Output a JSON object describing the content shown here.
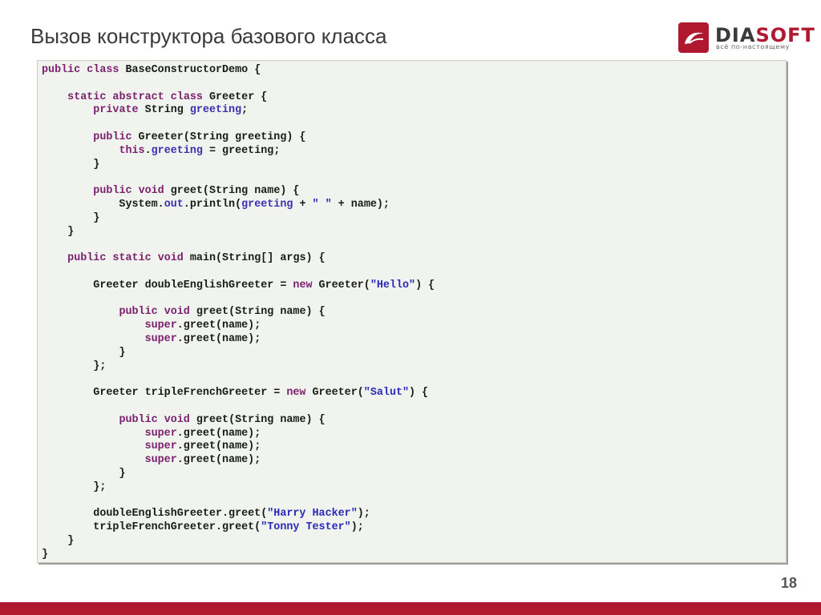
{
  "slide": {
    "title": "Вызов конструктора базового класса",
    "page_number": "18"
  },
  "logo": {
    "brand_dia": "DIA",
    "brand_soft": "SOFT",
    "tagline": "всё по-настоящему",
    "color": "#b0182f"
  },
  "code": {
    "language": "java",
    "lines": [
      "public class BaseConstructorDemo {",
      "",
      "    static abstract class Greeter {",
      "        private String greeting;",
      "",
      "        public Greeter(String greeting) {",
      "            this.greeting = greeting;",
      "        }",
      "",
      "        public void greet(String name) {",
      "            System.out.println(greeting + \" \" + name);",
      "        }",
      "    }",
      "",
      "    public static void main(String[] args) {",
      "",
      "        Greeter doubleEnglishGreeter = new Greeter(\"Hello\") {",
      "",
      "            public void greet(String name) {",
      "                super.greet(name);",
      "                super.greet(name);",
      "            }",
      "        };",
      "",
      "        Greeter tripleFrenchGreeter = new Greeter(\"Salut\") {",
      "",
      "            public void greet(String name) {",
      "                super.greet(name);",
      "                super.greet(name);",
      "                super.greet(name);",
      "            }",
      "        };",
      "",
      "        doubleEnglishGreeter.greet(\"Harry Hacker\");",
      "        tripleFrenchGreeter.greet(\"Tonny Tester\");",
      "    }",
      "}"
    ]
  },
  "colors": {
    "keyword": "#7a1f6e",
    "field": "#3b2fb0",
    "string": "#2a2ab8",
    "code_background": "#f1f4ee",
    "accent_bar": "#b0182f"
  }
}
